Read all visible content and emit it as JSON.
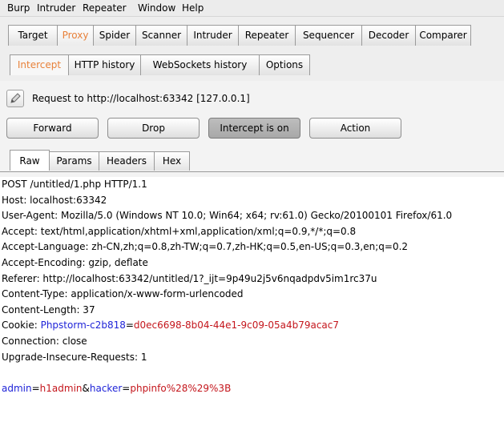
{
  "menu": [
    "Burp",
    "Intruder",
    "Repeater",
    "Window",
    "Help"
  ],
  "main_tabs": [
    "Target",
    "Proxy",
    "Spider",
    "Scanner",
    "Intruder",
    "Repeater",
    "Sequencer",
    "Decoder",
    "Comparer"
  ],
  "sub_tabs": [
    "Intercept",
    "HTTP history",
    "WebSockets history",
    "Options"
  ],
  "request_label": "Request to http://localhost:63342  [127.0.0.1]",
  "buttons": {
    "forward": "Forward",
    "drop": "Drop",
    "intercept": "Intercept is on",
    "action": "Action"
  },
  "view_tabs": [
    "Raw",
    "Params",
    "Headers",
    "Hex"
  ],
  "request_lines": [
    "POST /untitled/1.php HTTP/1.1",
    "Host: localhost:63342",
    "User-Agent: Mozilla/5.0 (Windows NT 10.0; Win64; x64; rv:61.0) Gecko/20100101 Firefox/61.0",
    "Accept: text/html,application/xhtml+xml,application/xml;q=0.9,*/*;q=0.8",
    "Accept-Language: zh-CN,zh;q=0.8,zh-TW;q=0.7,zh-HK;q=0.5,en-US;q=0.3,en;q=0.2",
    "Accept-Encoding: gzip, deflate",
    "Referer: http://localhost:63342/untitled/1?_ijt=9p49u2j5v6nqadpdv5im1rc37u",
    "Content-Type: application/x-www-form-urlencoded",
    "Content-Length: 37"
  ],
  "cookie": {
    "label": "Cookie: ",
    "name": "Phpstorm-c2b818",
    "eq": "=",
    "value": "d0ec6698-8b04-44e1-9c09-05a4b79acac7"
  },
  "request_lines_after": [
    "Connection: close",
    "Upgrade-Insecure-Requests: 1"
  ],
  "body_params": {
    "p1_name": "admin",
    "eq1": "=",
    "p1_value": "h1admin",
    "amp": "&",
    "p2_name": "hacker",
    "eq2": "=",
    "p2_value": "phpinfo%28%29%3B"
  }
}
